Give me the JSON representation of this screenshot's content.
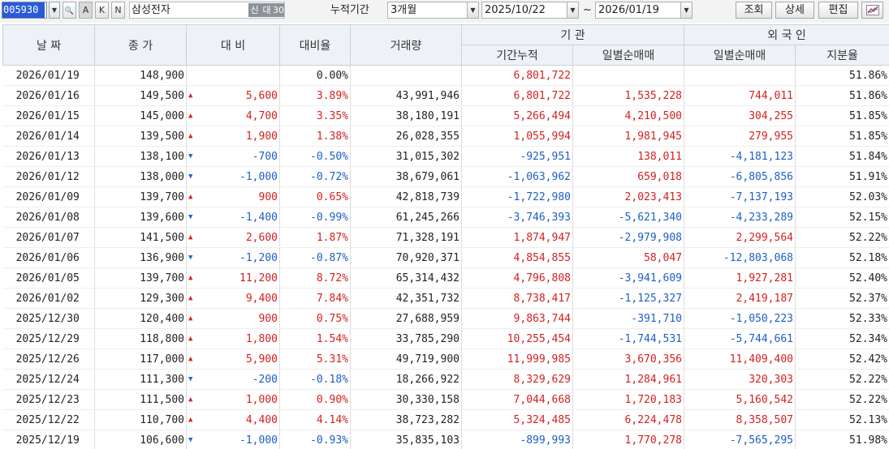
{
  "toolbar": {
    "code": "005930",
    "dropdown_glyph": "▼",
    "btn_search_glyph": "🔍",
    "btn_a": "A",
    "btn_k": "K",
    "btn_n": "N",
    "stock_name": "삼성전자",
    "badge_new": "신",
    "badge_loan": "대",
    "badge_margin": "30",
    "period_label": "누적기간",
    "period_value": "3개월",
    "from_date": "2025/10/22",
    "tilde": "~",
    "to_date": "2026/01/19",
    "btn_query": "조회",
    "btn_detail": "상세",
    "btn_edit": "편집",
    "btn_chart_icon": "chart-icon"
  },
  "headers": {
    "date": "날 짜",
    "close": "종 가",
    "change": "대 비",
    "change_rate": "대비율",
    "volume": "거래량",
    "institution": "기  관",
    "inst_cum": "기간누적",
    "inst_daily": "일별순매매",
    "foreign": "외 국 인",
    "for_daily": "일별순매매",
    "for_share": "지분율"
  },
  "rows": [
    {
      "date": "2026/01/19",
      "close": "148,900",
      "dir": "none",
      "change": "",
      "rate": "0.00%",
      "rate_dir": "none",
      "volume": "",
      "inst_cum": "6,801,722",
      "inst_cum_dir": "up",
      "inst_daily": "",
      "inst_daily_dir": "none",
      "for_daily": "",
      "for_daily_dir": "none",
      "share": "51.86%"
    },
    {
      "date": "2026/01/16",
      "close": "149,500",
      "dir": "up",
      "change": "5,600",
      "rate": "3.89%",
      "rate_dir": "up",
      "volume": "43,991,946",
      "inst_cum": "6,801,722",
      "inst_cum_dir": "up",
      "inst_daily": "1,535,228",
      "inst_daily_dir": "up",
      "for_daily": "744,011",
      "for_daily_dir": "up",
      "share": "51.86%"
    },
    {
      "date": "2026/01/15",
      "close": "145,000",
      "dir": "up",
      "change": "4,700",
      "rate": "3.35%",
      "rate_dir": "up",
      "volume": "38,180,191",
      "inst_cum": "5,266,494",
      "inst_cum_dir": "up",
      "inst_daily": "4,210,500",
      "inst_daily_dir": "up",
      "for_daily": "304,255",
      "for_daily_dir": "up",
      "share": "51.85%"
    },
    {
      "date": "2026/01/14",
      "close": "139,500",
      "dir": "up",
      "change": "1,900",
      "rate": "1.38%",
      "rate_dir": "up",
      "volume": "26,028,355",
      "inst_cum": "1,055,994",
      "inst_cum_dir": "up",
      "inst_daily": "1,981,945",
      "inst_daily_dir": "up",
      "for_daily": "279,955",
      "for_daily_dir": "up",
      "share": "51.85%"
    },
    {
      "date": "2026/01/13",
      "close": "138,100",
      "dir": "down",
      "change": "-700",
      "rate": "-0.50%",
      "rate_dir": "down",
      "volume": "31,015,302",
      "inst_cum": "-925,951",
      "inst_cum_dir": "down",
      "inst_daily": "138,011",
      "inst_daily_dir": "up",
      "for_daily": "-4,181,123",
      "for_daily_dir": "down",
      "share": "51.84%"
    },
    {
      "date": "2026/01/12",
      "close": "138,000",
      "dir": "down",
      "change": "-1,000",
      "rate": "-0.72%",
      "rate_dir": "down",
      "volume": "38,679,061",
      "inst_cum": "-1,063,962",
      "inst_cum_dir": "down",
      "inst_daily": "659,018",
      "inst_daily_dir": "up",
      "for_daily": "-6,805,856",
      "for_daily_dir": "down",
      "share": "51.91%"
    },
    {
      "date": "2026/01/09",
      "close": "139,700",
      "dir": "up",
      "change": "900",
      "rate": "0.65%",
      "rate_dir": "up",
      "volume": "42,818,739",
      "inst_cum": "-1,722,980",
      "inst_cum_dir": "down",
      "inst_daily": "2,023,413",
      "inst_daily_dir": "up",
      "for_daily": "-7,137,193",
      "for_daily_dir": "down",
      "share": "52.03%"
    },
    {
      "date": "2026/01/08",
      "close": "139,600",
      "dir": "down",
      "change": "-1,400",
      "rate": "-0.99%",
      "rate_dir": "down",
      "volume": "61,245,266",
      "inst_cum": "-3,746,393",
      "inst_cum_dir": "down",
      "inst_daily": "-5,621,340",
      "inst_daily_dir": "down",
      "for_daily": "-4,233,289",
      "for_daily_dir": "down",
      "share": "52.15%"
    },
    {
      "date": "2026/01/07",
      "close": "141,500",
      "dir": "up",
      "change": "2,600",
      "rate": "1.87%",
      "rate_dir": "up",
      "volume": "71,328,191",
      "inst_cum": "1,874,947",
      "inst_cum_dir": "up",
      "inst_daily": "-2,979,908",
      "inst_daily_dir": "down",
      "for_daily": "2,299,564",
      "for_daily_dir": "up",
      "share": "52.22%"
    },
    {
      "date": "2026/01/06",
      "close": "136,900",
      "dir": "down",
      "change": "-1,200",
      "rate": "-0.87%",
      "rate_dir": "down",
      "volume": "70,920,371",
      "inst_cum": "4,854,855",
      "inst_cum_dir": "up",
      "inst_daily": "58,047",
      "inst_daily_dir": "up",
      "for_daily": "-12,803,068",
      "for_daily_dir": "down",
      "share": "52.18%"
    },
    {
      "date": "2026/01/05",
      "close": "139,700",
      "dir": "up",
      "change": "11,200",
      "rate": "8.72%",
      "rate_dir": "up",
      "volume": "65,314,432",
      "inst_cum": "4,796,808",
      "inst_cum_dir": "up",
      "inst_daily": "-3,941,609",
      "inst_daily_dir": "down",
      "for_daily": "1,927,281",
      "for_daily_dir": "up",
      "share": "52.40%"
    },
    {
      "date": "2026/01/02",
      "close": "129,300",
      "dir": "up",
      "change": "9,400",
      "rate": "7.84%",
      "rate_dir": "up",
      "volume": "42,351,732",
      "inst_cum": "8,738,417",
      "inst_cum_dir": "up",
      "inst_daily": "-1,125,327",
      "inst_daily_dir": "down",
      "for_daily": "2,419,187",
      "for_daily_dir": "up",
      "share": "52.37%"
    },
    {
      "date": "2025/12/30",
      "close": "120,400",
      "dir": "up",
      "change": "900",
      "rate": "0.75%",
      "rate_dir": "up",
      "volume": "27,688,959",
      "inst_cum": "9,863,744",
      "inst_cum_dir": "up",
      "inst_daily": "-391,710",
      "inst_daily_dir": "down",
      "for_daily": "-1,050,223",
      "for_daily_dir": "down",
      "share": "52.33%"
    },
    {
      "date": "2025/12/29",
      "close": "118,800",
      "dir": "up",
      "change": "1,800",
      "rate": "1.54%",
      "rate_dir": "up",
      "volume": "33,785,290",
      "inst_cum": "10,255,454",
      "inst_cum_dir": "up",
      "inst_daily": "-1,744,531",
      "inst_daily_dir": "down",
      "for_daily": "-5,744,661",
      "for_daily_dir": "down",
      "share": "52.34%"
    },
    {
      "date": "2025/12/26",
      "close": "117,000",
      "dir": "up",
      "change": "5,900",
      "rate": "5.31%",
      "rate_dir": "up",
      "volume": "49,719,900",
      "inst_cum": "11,999,985",
      "inst_cum_dir": "up",
      "inst_daily": "3,670,356",
      "inst_daily_dir": "up",
      "for_daily": "11,409,400",
      "for_daily_dir": "up",
      "share": "52.42%"
    },
    {
      "date": "2025/12/24",
      "close": "111,300",
      "dir": "down",
      "change": "-200",
      "rate": "-0.18%",
      "rate_dir": "down",
      "volume": "18,266,922",
      "inst_cum": "8,329,629",
      "inst_cum_dir": "up",
      "inst_daily": "1,284,961",
      "inst_daily_dir": "up",
      "for_daily": "320,303",
      "for_daily_dir": "up",
      "share": "52.22%"
    },
    {
      "date": "2025/12/23",
      "close": "111,500",
      "dir": "up",
      "change": "1,000",
      "rate": "0.90%",
      "rate_dir": "up",
      "volume": "30,330,158",
      "inst_cum": "7,044,668",
      "inst_cum_dir": "up",
      "inst_daily": "1,720,183",
      "inst_daily_dir": "up",
      "for_daily": "5,160,542",
      "for_daily_dir": "up",
      "share": "52.22%"
    },
    {
      "date": "2025/12/22",
      "close": "110,700",
      "dir": "up",
      "change": "4,400",
      "rate": "4.14%",
      "rate_dir": "up",
      "volume": "38,723,282",
      "inst_cum": "5,324,485",
      "inst_cum_dir": "up",
      "inst_daily": "6,224,478",
      "inst_daily_dir": "up",
      "for_daily": "8,358,507",
      "for_daily_dir": "up",
      "share": "52.13%"
    },
    {
      "date": "2025/12/19",
      "close": "106,600",
      "dir": "down",
      "change": "-1,000",
      "rate": "-0.93%",
      "rate_dir": "down",
      "volume": "35,835,103",
      "inst_cum": "-899,993",
      "inst_cum_dir": "down",
      "inst_daily": "1,770,278",
      "inst_daily_dir": "up",
      "for_daily": "-7,565,295",
      "for_daily_dir": "down",
      "share": "51.98%"
    }
  ],
  "colors": {
    "up": "#d42020",
    "down": "#1c5fc4",
    "header_bg": "#eef2f7"
  }
}
